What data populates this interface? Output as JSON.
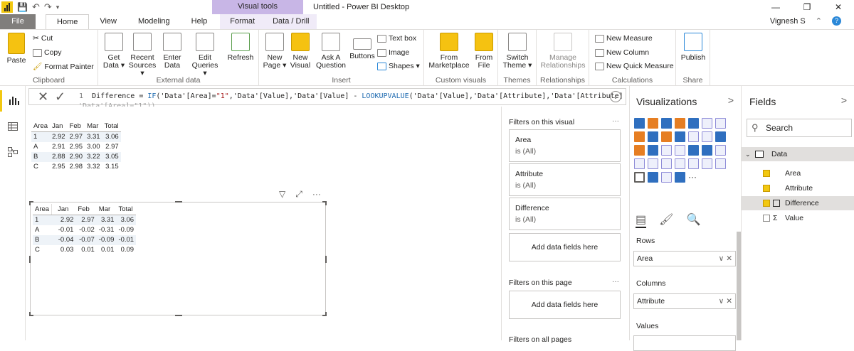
{
  "window": {
    "title": "Untitled - Power BI Desktop",
    "context_tab": "Visual tools",
    "user": "Vignesh S",
    "controls": [
      "—",
      "❐",
      "✕"
    ]
  },
  "tabs": [
    "File",
    "Home",
    "View",
    "Modeling",
    "Help",
    "Format",
    "Data / Drill"
  ],
  "ribbon": {
    "groups": {
      "clipboard": "Clipboard",
      "external": "External data",
      "insert": "Insert",
      "custom": "Custom visuals",
      "themes": "Themes",
      "relationships": "Relationships",
      "calculations": "Calculations",
      "share": "Share"
    },
    "paste": "Paste",
    "cut": "Cut",
    "copy": "Copy",
    "format_painter": "Format Painter",
    "get_data": [
      "Get",
      "Data ▾"
    ],
    "recent_sources": [
      "Recent",
      "Sources ▾"
    ],
    "enter_data": [
      "Enter",
      "Data"
    ],
    "edit_queries": [
      "Edit",
      "Queries ▾"
    ],
    "refresh": "Refresh",
    "new_page": [
      "New",
      "Page ▾"
    ],
    "new_visual": [
      "New",
      "Visual"
    ],
    "ask_question": [
      "Ask A",
      "Question"
    ],
    "buttons": "Buttons",
    "text_box": "Text box",
    "image": "Image",
    "shapes": "Shapes ▾",
    "from_marketplace": [
      "From",
      "Marketplace"
    ],
    "from_file": [
      "From",
      "File"
    ],
    "switch_theme": [
      "Switch",
      "Theme ▾"
    ],
    "manage_rel": [
      "Manage",
      "Relationships"
    ],
    "new_measure": "New Measure",
    "new_column": "New Column",
    "new_quick_measure": "New Quick Measure",
    "publish": "Publish"
  },
  "formula": {
    "line": "1",
    "name": "Difference",
    "text_a": " = ",
    "kw_if": "IF",
    "text_b": "('Data'[Area]=",
    "str1": "\"1\"",
    "text_c": ",'Data'[Value],'Data'[Value] - ",
    "kw_lookup": "LOOKUPVALUE",
    "text_d": "('Data'[Value],'Data'[Attribute],'Data'[Attribute]",
    "line2": "    'Data'[Area]=\"1\"))"
  },
  "matrix1": {
    "headers": [
      "Area",
      "Jan",
      "Feb",
      "Mar",
      "Total"
    ],
    "rows": [
      [
        "1",
        "2.92",
        "2.97",
        "3.31",
        "3.06"
      ],
      [
        "A",
        "2.91",
        "2.95",
        "3.00",
        "2.97"
      ],
      [
        "B",
        "2.88",
        "2.90",
        "3.22",
        "3.05"
      ],
      [
        "C",
        "2.95",
        "2.98",
        "3.32",
        "3.15"
      ]
    ]
  },
  "matrix2": {
    "headers": [
      "Area",
      "Jan",
      "Feb",
      "Mar",
      "Total"
    ],
    "rows": [
      [
        "1",
        "2.92",
        "2.97",
        "3.31",
        "3.06"
      ],
      [
        "A",
        "-0.01",
        "-0.02",
        "-0.31",
        "-0.09"
      ],
      [
        "B",
        "-0.04",
        "-0.07",
        "-0.09",
        "-0.01"
      ],
      [
        "C",
        "0.03",
        "0.01",
        "0.01",
        "0.09"
      ]
    ]
  },
  "filters": {
    "on_visual": "Filters on this visual",
    "cards": [
      {
        "field": "Area",
        "state": "is (All)"
      },
      {
        "field": "Attribute",
        "state": "is (All)"
      },
      {
        "field": "Difference",
        "state": "is (All)"
      }
    ],
    "add_fields": "Add data fields here",
    "on_page": "Filters on this page",
    "add_fields_page": "Add data fields here",
    "on_all": "Filters on all pages",
    "dots": "···"
  },
  "visualizations": {
    "title": "Visualizations",
    "chevron": ">",
    "rows_label": "Rows",
    "rows_value": "Area",
    "columns_label": "Columns",
    "columns_value": "Attribute",
    "values_label": "Values",
    "well_actions": "∨ ✕",
    "more": "···"
  },
  "fields": {
    "title": "Fields",
    "chevron": ">",
    "search_placeholder": "Search",
    "table": "Data",
    "items": [
      {
        "name": "Area",
        "checked": true,
        "icon": ""
      },
      {
        "name": "Attribute",
        "checked": true,
        "icon": ""
      },
      {
        "name": "Difference",
        "checked": true,
        "icon": "calculator-icon"
      },
      {
        "name": "Value",
        "checked": false,
        "icon": "sigma-icon"
      }
    ]
  }
}
